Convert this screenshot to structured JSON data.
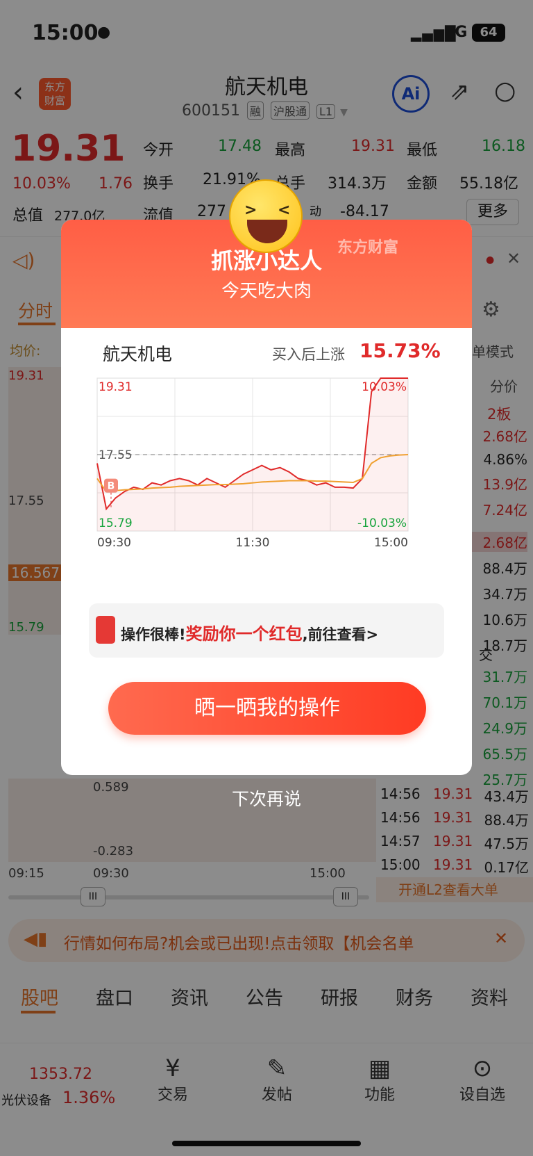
{
  "status": {
    "time": "15:00",
    "network": "5G",
    "battery": "64"
  },
  "header": {
    "title": "航天机电",
    "code": "600151",
    "tags": [
      "融",
      "沪股通",
      "L1"
    ]
  },
  "quote": {
    "price": "19.31",
    "pct": "10.03%",
    "change": "1.76",
    "open_label": "今开",
    "open": "17.48",
    "high_label": "最高",
    "high": "19.31",
    "low_label": "最低",
    "low": "16.18",
    "turnover_label": "换手",
    "turnover": "21.91%",
    "volume_label": "总手",
    "volume": "314.3万",
    "amount_label": "金额",
    "amount": "55.18亿",
    "mcap_label": "总值",
    "mcap": "277.0亿",
    "float_label": "流值",
    "float": "277",
    "pe_label": "动",
    "pe": "-84.17",
    "more": "更多"
  },
  "bg": {
    "tab_active": "分时",
    "avg_label": "均价:",
    "mode": "单模式",
    "fenjia": "分价",
    "board": "2板",
    "side_values": [
      "2.68亿",
      "4.86%",
      "13.9亿",
      "7.24亿",
      "2.68亿",
      "88.4万",
      "34.7万",
      "10.6万",
      "18.7万"
    ],
    "deal_label": "交",
    "vol_list": [
      "31.7万",
      "70.1万",
      "24.9万",
      "65.5万",
      "25.7万"
    ],
    "trades": [
      [
        "14:56",
        "19.31",
        "43.4万"
      ],
      [
        "14:56",
        "19.31",
        "88.4万"
      ],
      [
        "14:57",
        "19.31",
        "47.5万"
      ],
      [
        "15:00",
        "19.31",
        "0.17亿"
      ]
    ],
    "l2": "开通L2查看大单",
    "left_prices": [
      "19.31",
      "17.55",
      "16.567",
      "15.79"
    ],
    "macd_top": "0.589",
    "macd_bottom": "-0.283",
    "times": [
      "09:15",
      "09:30",
      "15:00"
    ],
    "banner": "行情如何布局?机会或已出现!点击领取【机会名单",
    "tabs": [
      "股吧",
      "盘口",
      "资讯",
      "公告",
      "研报",
      "财务",
      "资料"
    ],
    "bottom": {
      "index_value": "1353.72",
      "index_name": "光伏设备",
      "index_pct": "1.36%",
      "items": [
        "交易",
        "发帖",
        "功能",
        "设自选"
      ]
    }
  },
  "modal": {
    "brand": "东方财富",
    "title": "抓涨小达人",
    "subtitle": "今天吃大肉",
    "stock": "航天机电",
    "gain_label": "买入后上涨",
    "gain": "15.73%",
    "reward_a": "操作很棒!",
    "reward_b": "奖励你一个红包",
    "reward_c": ",前往查看>",
    "button": "晒一晒我的操作",
    "dismiss": "下次再说"
  },
  "chart_data": {
    "type": "line",
    "title": "",
    "x_ticks": [
      "09:30",
      "11:30",
      "15:00"
    ],
    "y_labels": {
      "top": "19.31",
      "mid": "17.55",
      "bottom": "15.79",
      "top_pct": "10.03%",
      "bottom_pct": "-10.03%"
    },
    "ylim": [
      15.79,
      19.31
    ],
    "reference": 17.55,
    "buy_marker": {
      "label": "B",
      "time": "09:30",
      "price": 16.58
    },
    "series": [
      {
        "name": "",
        "color": "#e02a2a",
        "values": [
          17.35,
          16.3,
          16.55,
          16.7,
          16.8,
          16.75,
          16.9,
          16.85,
          16.95,
          17.0,
          16.95,
          16.85,
          17.0,
          16.9,
          16.8,
          16.95,
          17.1,
          17.2,
          17.3,
          17.2,
          17.25,
          17.15,
          17.0,
          16.95,
          16.85,
          16.9,
          16.8,
          16.8,
          16.78,
          17.0,
          19.0,
          19.31,
          19.31,
          19.31,
          19.31
        ]
      },
      {
        "name": "",
        "color": "#f0a030",
        "values": [
          17.0,
          16.7,
          16.72,
          16.74,
          16.75,
          16.76,
          16.78,
          16.79,
          16.8,
          16.82,
          16.83,
          16.84,
          16.85,
          16.86,
          16.86,
          16.87,
          16.88,
          16.9,
          16.92,
          16.93,
          16.94,
          16.95,
          16.95,
          16.95,
          16.94,
          16.94,
          16.93,
          16.92,
          16.91,
          17.0,
          17.35,
          17.48,
          17.52,
          17.54,
          17.55
        ]
      }
    ]
  }
}
